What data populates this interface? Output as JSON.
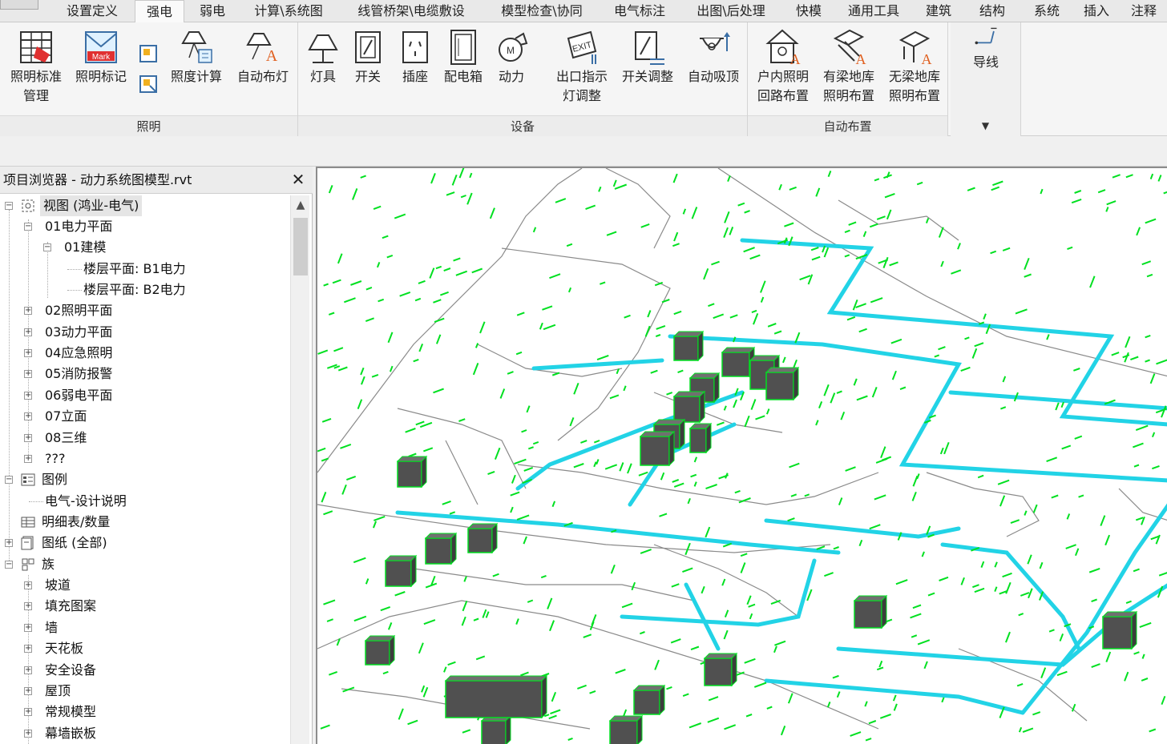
{
  "ribbon": {
    "tabs": [
      {
        "label": "设置定义"
      },
      {
        "label": "强电"
      },
      {
        "label": "弱电"
      },
      {
        "label": "计算\\系统图"
      },
      {
        "label": "线管桥架\\电缆敷设"
      },
      {
        "label": "模型检查\\协同"
      },
      {
        "label": "电气标注"
      },
      {
        "label": "出图\\后处理"
      },
      {
        "label": "快模"
      },
      {
        "label": "通用工具"
      },
      {
        "label": "建筑"
      },
      {
        "label": "结构"
      },
      {
        "label": "系统"
      },
      {
        "label": "插入"
      },
      {
        "label": "注释"
      }
    ],
    "active_tab": "强电",
    "panels": {
      "lighting": {
        "title": "照明",
        "tools": {
          "lighting_std": [
            "照明标准",
            "管理"
          ],
          "lighting_mark": [
            "照明标记"
          ],
          "illum_calc": [
            "照度计算"
          ],
          "auto_lights": [
            "自动布灯"
          ]
        },
        "mark_icon_text": "Mark"
      },
      "devices": {
        "title": "设备",
        "tools": {
          "fixture": [
            "灯具"
          ],
          "switch": [
            "开关"
          ],
          "socket": [
            "插座"
          ],
          "panelboard": [
            "配电箱"
          ],
          "power": [
            "动力"
          ],
          "exit": [
            "出口指示",
            "灯调整"
          ],
          "switch_adjust": [
            "开关调整"
          ],
          "auto_ceiling": [
            "自动吸顶"
          ]
        },
        "exit_icon_text": "EXIT"
      },
      "auto_layout": {
        "title": "自动布置",
        "tools": {
          "household": [
            "户内照明",
            "回路布置"
          ],
          "beam_garage": [
            "有梁地库",
            "照明布置"
          ],
          "nobeam_garage": [
            "无梁地库",
            "照明布置"
          ]
        }
      },
      "wire": {
        "tools": {
          "wire": [
            "导线"
          ]
        }
      }
    }
  },
  "browser": {
    "title": "项目浏览器 - 动力系统图模型.rvt",
    "close": "✕",
    "items": {
      "views": "视图 (鸿业-电气)",
      "power_plan": "01电力平面",
      "modeling": "01建模",
      "b1": "楼层平面: B1电力",
      "b2": "楼层平面: B2电力",
      "lighting_plan": "02照明平面",
      "power2": "03动力平面",
      "emergency": "04应急照明",
      "fire_alarm": "05消防报警",
      "weak": "06弱电平面",
      "elev": "07立面",
      "three_d": "08三维",
      "unknown": "???",
      "legend": "图例",
      "elec_notes": "电气-设计说明",
      "schedules": "明细表/数量",
      "sheets": "图纸 (全部)",
      "families": "族",
      "ramp": "坡道",
      "fill_pattern": "填充图案",
      "wall": "墙",
      "ceiling": "天花板",
      "safety": "安全设备",
      "roof": "屋顶",
      "generic": "常规模型",
      "curtain_panel": "幕墙嵌板"
    }
  },
  "colors": {
    "cable_tray": "#22d3e6",
    "fixture": "#00e020",
    "equipment": "#505050",
    "wall_line": "#8a8a8a"
  }
}
